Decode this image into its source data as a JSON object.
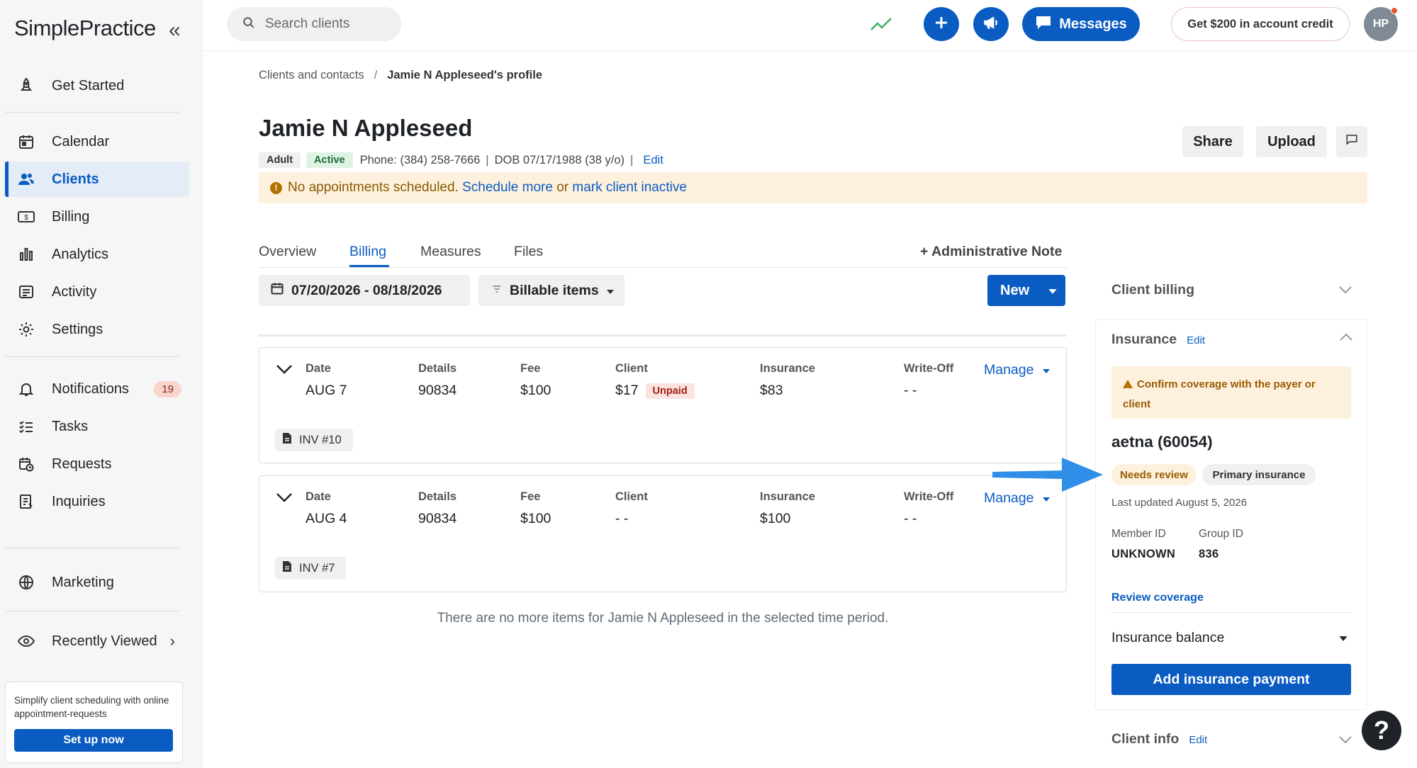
{
  "app": {
    "logo_text": "SimplePractice",
    "collapse_glyph": "«"
  },
  "sidebar": {
    "items": [
      {
        "label": "Get Started",
        "icon": "rocket-icon"
      },
      {
        "label": "Calendar",
        "icon": "calendar-icon"
      },
      {
        "label": "Clients",
        "icon": "users-icon",
        "active": true
      },
      {
        "label": "Billing",
        "icon": "dollar-card-icon"
      },
      {
        "label": "Analytics",
        "icon": "bar-chart-icon"
      },
      {
        "label": "Activity",
        "icon": "list-icon"
      },
      {
        "label": "Settings",
        "icon": "gear-icon"
      },
      {
        "label": "Notifications",
        "icon": "bell-icon",
        "badge": "19"
      },
      {
        "label": "Tasks",
        "icon": "checklist-icon"
      },
      {
        "label": "Requests",
        "icon": "calendar-clock-icon"
      },
      {
        "label": "Inquiries",
        "icon": "document-icon"
      },
      {
        "label": "Marketing",
        "icon": "globe-icon"
      },
      {
        "label": "Recently Viewed",
        "icon": "eye-icon"
      }
    ],
    "promo": {
      "text": "Simplify client scheduling with online appointment-requests",
      "button": "Set up now"
    }
  },
  "topbar": {
    "search_placeholder": "Search clients",
    "messages_label": "Messages",
    "credit_label": "Get $200 in account credit",
    "avatar_initials": "HP"
  },
  "breadcrumb": {
    "parent": "Clients and contacts",
    "separator": "/",
    "current": "Jamie N Appleseed's profile"
  },
  "client": {
    "name": "Jamie N Appleseed",
    "tag_adult": "Adult",
    "tag_active": "Active",
    "phone": "Phone: (384) 258-7666",
    "dob": "DOB 07/17/1988 (38 y/o)",
    "edit": "Edit",
    "pipe": "|"
  },
  "header_buttons": {
    "share": "Share",
    "upload": "Upload"
  },
  "alert": {
    "text": "No appointments scheduled.",
    "link1": "Schedule more",
    "middle": "or",
    "link2": "mark client inactive"
  },
  "tabs": [
    {
      "label": "Overview"
    },
    {
      "label": "Billing",
      "active": true
    },
    {
      "label": "Measures"
    },
    {
      "label": "Files"
    }
  ],
  "admin_note": "+ Administrative Note",
  "toolbar": {
    "date_range": "07/20/2026 - 08/18/2026",
    "filter": "Billable items",
    "new": "New"
  },
  "columns": {
    "date": "Date",
    "details": "Details",
    "fee": "Fee",
    "client": "Client",
    "insurance": "Insurance",
    "writeoff": "Write-Off",
    "manage": "Manage"
  },
  "billing_items": [
    {
      "date": "AUG 7",
      "details": "90834",
      "fee": "$100",
      "client": "$17",
      "client_status": "Unpaid",
      "insurance": "$83",
      "writeoff": "- -",
      "invoice": "INV #10"
    },
    {
      "date": "AUG 4",
      "details": "90834",
      "fee": "$100",
      "client": "- -",
      "insurance": "$100",
      "writeoff": "- -",
      "invoice": "INV #7"
    }
  ],
  "no_more_text": "There are no more items for Jamie N Appleseed in the selected time period.",
  "right_panel": {
    "client_billing": "Client billing",
    "insurance_title": "Insurance",
    "insurance_edit": "Edit",
    "warning": "Confirm coverage with the payer or client",
    "payer": "aetna (60054)",
    "pill_review": "Needs review",
    "pill_primary": "Primary insurance",
    "updated": "Last updated August 5, 2026",
    "member_id_label": "Member ID",
    "member_id": "UNKNOWN",
    "group_id_label": "Group ID",
    "group_id": "836",
    "review_coverage": "Review coverage",
    "insurance_balance": "Insurance balance",
    "add_payment": "Add insurance payment",
    "client_info": "Client info",
    "client_info_edit": "Edit"
  },
  "help": "?",
  "colors": {
    "primary": "#0a5cc2",
    "alert_bg": "#fdf1de",
    "annotation_arrow": "#2f8ee8"
  }
}
